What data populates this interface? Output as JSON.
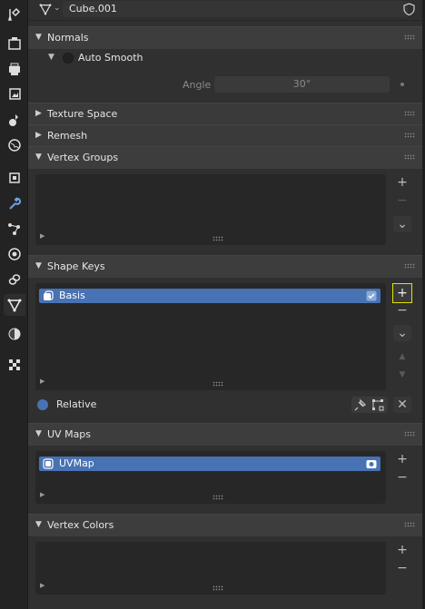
{
  "header": {
    "object_name": "Cube.001",
    "data_icon": "mesh-data-icon",
    "dropdown_icon": "chevron-down-icon",
    "fake_user_icon": "shield-icon"
  },
  "tabs": [
    "tool-icon",
    "render-icon",
    "output-icon",
    "view-layer-icon",
    "scene-icon",
    "world-icon",
    "object-icon",
    "modifier-icon",
    "particles-icon",
    "physics-icon",
    "constraints-icon",
    "data-icon",
    "material-icon",
    "texture-icon"
  ],
  "normals": {
    "title": "Normals",
    "auto_smooth_label": "Auto Smooth",
    "angle_label": "Angle",
    "angle_value": "30°"
  },
  "panels": {
    "texture_space": "Texture Space",
    "remesh": "Remesh",
    "vertex_groups": "Vertex Groups"
  },
  "shape_keys": {
    "title": "Shape Keys",
    "items": [
      {
        "label": "Basis"
      }
    ],
    "relative_label": "Relative"
  },
  "uv_maps": {
    "title": "UV Maps",
    "items": [
      {
        "label": "UVMap"
      }
    ]
  },
  "vertex_colors": {
    "title": "Vertex Colors"
  },
  "buttons": {
    "add": "+",
    "remove": "−",
    "menu": "⌄",
    "up": "▲",
    "down": "▼",
    "clear": "✕"
  },
  "colors": {
    "accent": "#4772b3",
    "highlight": "#e2e200",
    "panel_bg": "#303030"
  }
}
